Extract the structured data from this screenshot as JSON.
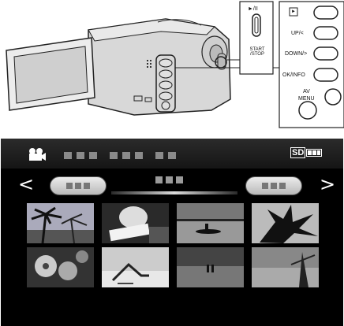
{
  "panel_buttons": {
    "rec_label": "►/II",
    "start_stop": "START\n/STOP",
    "play_icon": "►",
    "up": "UP/<",
    "down": "DOWN/>",
    "ok_info": "OK/INFO",
    "av": "AV",
    "menu": "MENU"
  },
  "screen": {
    "mode_icon": "video-camera-icon",
    "storage": "SD",
    "battery_icon": "battery-full-icon",
    "left_arrow": "<",
    "right_arrow": ">"
  },
  "thumbnails": [
    "palm-trees-beach-thumbnail",
    "person-reading-thumbnail",
    "boat-on-lake-thumbnail",
    "leaves-silhouette-thumbnail",
    "flowers-thumbnail",
    "beach-chair-thumbnail",
    "couple-sunset-thumbnail",
    "lake-tree-thumbnail"
  ],
  "colors": {
    "screen_bg": "#000000",
    "topbar": "#222222",
    "pill": "#d0d0d0"
  }
}
